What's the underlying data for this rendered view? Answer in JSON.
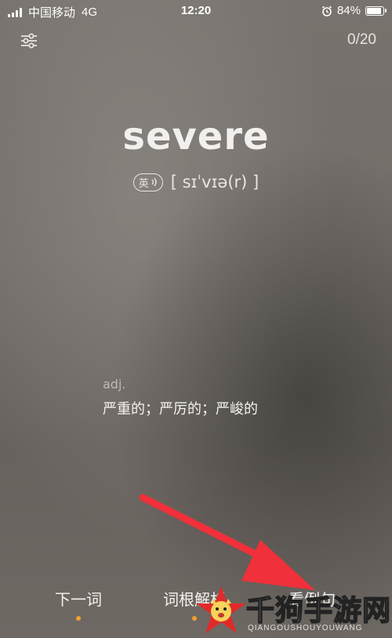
{
  "status_bar": {
    "carrier": "中国移动",
    "network": "4G",
    "time": "12:20",
    "battery": "84%",
    "battery_level": 0.84
  },
  "header": {
    "progress": "0/20",
    "settings_icon": "sliders-icon"
  },
  "word": {
    "text": "severe",
    "lang_label": "英",
    "phonetic": "[ sɪˈvɪə(r) ]"
  },
  "definition": {
    "pos": "adj.",
    "meaning": "严重的；严厉的；严峻的"
  },
  "tabs": [
    {
      "label": "下一词"
    },
    {
      "label": "词根解析"
    },
    {
      "label": "看例句"
    }
  ],
  "watermark": {
    "title": "千狗手游网",
    "subtitle": "QIANGOUSHOUYOUWANG"
  },
  "colors": {
    "accent_dot": "#f0a030",
    "arrow": "#f0303a"
  }
}
